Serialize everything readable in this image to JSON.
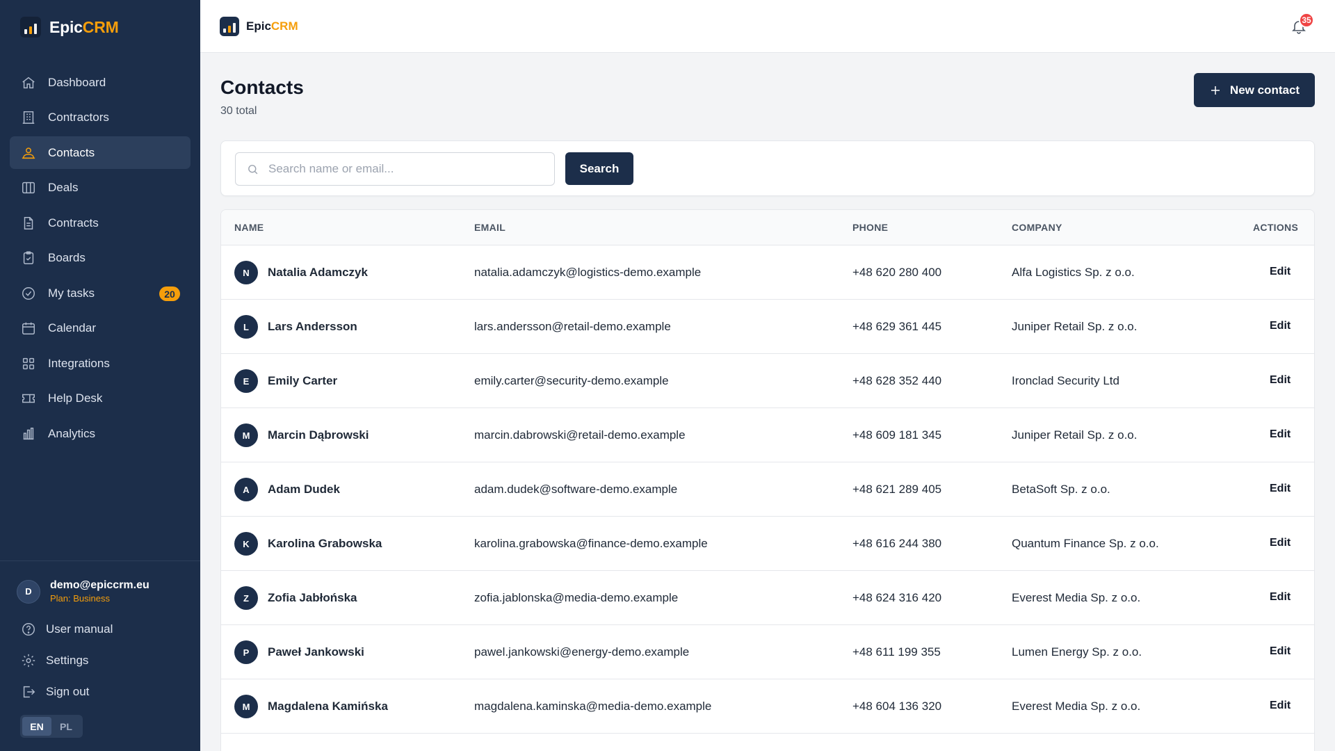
{
  "brand": {
    "name_main": "Epic",
    "name_accent": "CRM"
  },
  "sidebar": {
    "items": [
      {
        "label": "Dashboard",
        "icon": "home-icon"
      },
      {
        "label": "Contractors",
        "icon": "building-icon"
      },
      {
        "label": "Contacts",
        "icon": "users-icon",
        "active": true
      },
      {
        "label": "Deals",
        "icon": "columns-icon"
      },
      {
        "label": "Contracts",
        "icon": "document-icon"
      },
      {
        "label": "Boards",
        "icon": "clipboard-icon"
      },
      {
        "label": "My tasks",
        "icon": "check-circle-icon",
        "badge": "20"
      },
      {
        "label": "Calendar",
        "icon": "calendar-icon"
      },
      {
        "label": "Integrations",
        "icon": "grid-icon"
      },
      {
        "label": "Help Desk",
        "icon": "ticket-icon"
      },
      {
        "label": "Analytics",
        "icon": "bar-chart-icon"
      }
    ],
    "user": {
      "initial": "D",
      "email": "demo@epiccrm.eu",
      "plan": "Plan: Business"
    },
    "user_manual": "User manual",
    "settings": "Settings",
    "sign_out": "Sign out",
    "lang": {
      "en": "EN",
      "pl": "PL",
      "selected": "EN"
    }
  },
  "topbar": {
    "notifications_count": "35"
  },
  "page": {
    "title": "Contacts",
    "subtitle": "30 total",
    "new_button": "New contact"
  },
  "search": {
    "placeholder": "Search name or email...",
    "value": "",
    "button": "Search"
  },
  "table": {
    "headers": {
      "name": "NAME",
      "email": "EMAIL",
      "phone": "PHONE",
      "company": "COMPANY",
      "actions": "ACTIONS"
    },
    "edit_label": "Edit",
    "rows": [
      {
        "initial": "N",
        "name": "Natalia Adamczyk",
        "email": "natalia.adamczyk@logistics-demo.example",
        "phone": "+48 620 280 400",
        "company": "Alfa Logistics Sp. z o.o."
      },
      {
        "initial": "L",
        "name": "Lars Andersson",
        "email": "lars.andersson@retail-demo.example",
        "phone": "+48 629 361 445",
        "company": "Juniper Retail Sp. z o.o."
      },
      {
        "initial": "E",
        "name": "Emily Carter",
        "email": "emily.carter@security-demo.example",
        "phone": "+48 628 352 440",
        "company": "Ironclad Security Ltd"
      },
      {
        "initial": "M",
        "name": "Marcin Dąbrowski",
        "email": "marcin.dabrowski@retail-demo.example",
        "phone": "+48 609 181 345",
        "company": "Juniper Retail Sp. z o.o."
      },
      {
        "initial": "A",
        "name": "Adam Dudek",
        "email": "adam.dudek@software-demo.example",
        "phone": "+48 621 289 405",
        "company": "BetaSoft Sp. z o.o."
      },
      {
        "initial": "K",
        "name": "Karolina Grabowska",
        "email": "karolina.grabowska@finance-demo.example",
        "phone": "+48 616 244 380",
        "company": "Quantum Finance Sp. z o.o."
      },
      {
        "initial": "Z",
        "name": "Zofia Jabłońska",
        "email": "zofia.jablonska@media-demo.example",
        "phone": "+48 624 316 420",
        "company": "Everest Media Sp. z o.o."
      },
      {
        "initial": "P",
        "name": "Paweł Jankowski",
        "email": "pawel.jankowski@energy-demo.example",
        "phone": "+48 611 199 355",
        "company": "Lumen Energy Sp. z o.o."
      },
      {
        "initial": "M",
        "name": "Magdalena Kamińska",
        "email": "magdalena.kaminska@media-demo.example",
        "phone": "+48 604 136 320",
        "company": "Everest Media Sp. z o.o."
      }
    ]
  },
  "colors": {
    "sidebar_bg": "#1c2e4a",
    "accent": "#f59e0b",
    "primary_button": "#1c2e4a",
    "notification_badge": "#ef4444"
  }
}
